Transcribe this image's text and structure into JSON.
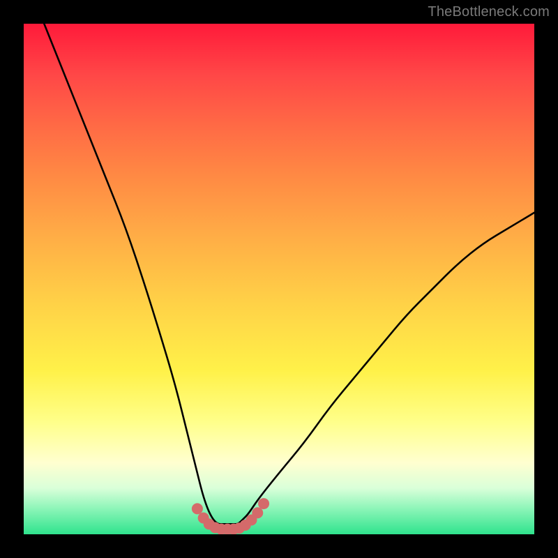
{
  "watermark": "TheBottleneck.com",
  "chart_data": {
    "type": "line",
    "title": "",
    "xlabel": "",
    "ylabel": "",
    "xlim": [
      0,
      100
    ],
    "ylim": [
      0,
      100
    ],
    "series": [
      {
        "name": "bottleneck-curve",
        "x": [
          4,
          8,
          12,
          16,
          20,
          24,
          28,
          30,
          32,
          34,
          35,
          36,
          37,
          38,
          39,
          40,
          41,
          42,
          43,
          44,
          46,
          50,
          55,
          60,
          65,
          70,
          75,
          80,
          85,
          90,
          95,
          100
        ],
        "y": [
          100,
          90,
          80,
          70,
          60,
          48,
          35,
          28,
          20,
          12,
          8,
          5,
          3,
          2,
          2,
          2,
          2,
          2,
          3,
          4,
          7,
          12,
          18,
          25,
          31,
          37,
          43,
          48,
          53,
          57,
          60,
          63
        ]
      }
    ],
    "markers": {
      "name": "bottom-markers",
      "color": "#d46a6a",
      "points_x": [
        34.0,
        35.2,
        36.3,
        37.5,
        38.7,
        39.9,
        41.1,
        42.2,
        43.4,
        44.6,
        45.8,
        47.0
      ],
      "points_y": [
        5.0,
        3.2,
        2.0,
        1.3,
        1.0,
        1.0,
        1.0,
        1.2,
        1.8,
        2.8,
        4.2,
        6.0
      ]
    },
    "background_gradient": {
      "top": "#ff1a3a",
      "mid": "#ffff66",
      "bottom": "#2fe38d"
    }
  }
}
